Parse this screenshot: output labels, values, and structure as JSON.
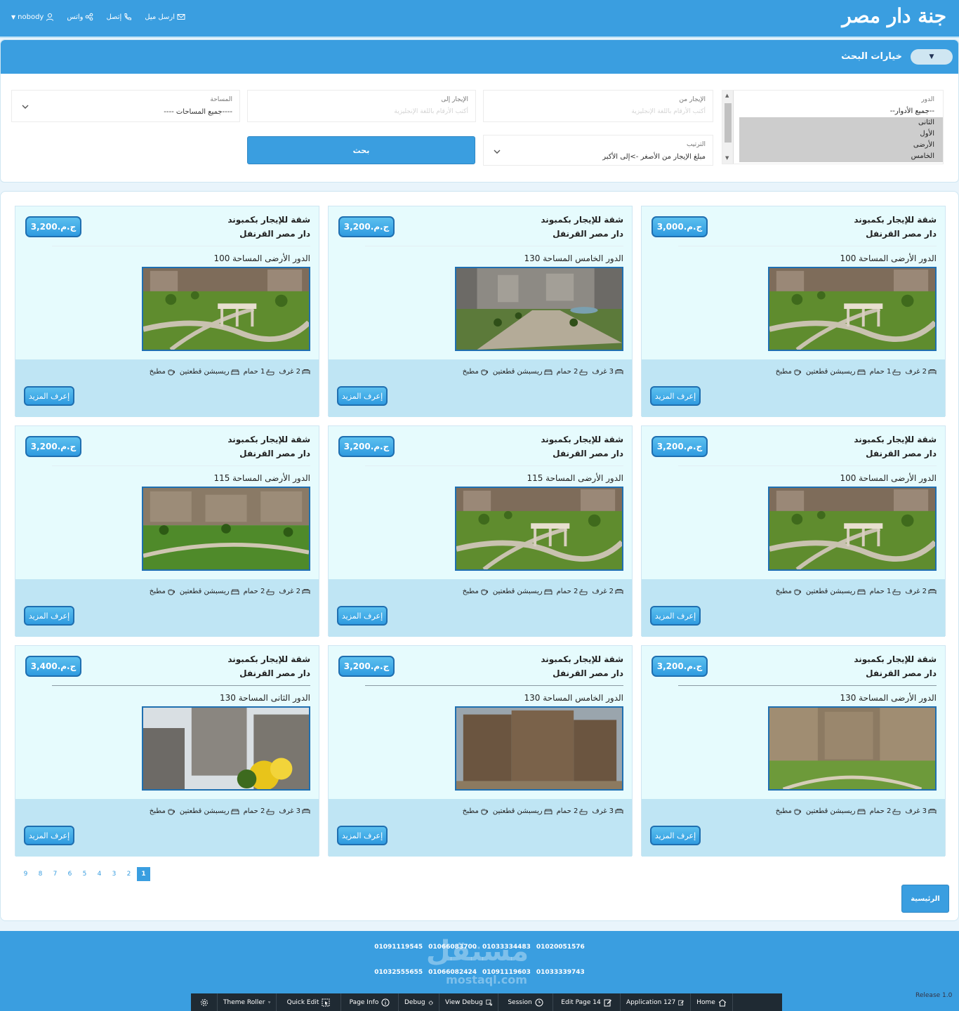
{
  "header": {
    "brand": "جنة دار مصر",
    "links": [
      {
        "label": "ارسل ميل",
        "icon": "mail-icon"
      },
      {
        "label": "إتصل",
        "icon": "phone-icon"
      },
      {
        "label": "واتس",
        "icon": "share-icon"
      },
      {
        "label": "nobody",
        "icon": "user-icon"
      }
    ]
  },
  "search": {
    "title": "خيارات البحث",
    "collapse_icon": "▼",
    "floor": {
      "label": "الدور",
      "options": [
        "--جميع الأدوار--",
        "الثانى",
        "الأول",
        "الأرضى",
        "الخامس"
      ]
    },
    "rent_from": {
      "label": "الإيجار من",
      "placeholder": "أكتب الأرقام باللغة الإنجليزية"
    },
    "rent_to": {
      "label": "الإيجار إلى",
      "placeholder": "أكتب الأرقام باللغة الإنجليزية"
    },
    "area": {
      "label": "المساحة",
      "value": "----جميع المساحات ----"
    },
    "sort": {
      "label": "الترتيب",
      "value": "مبلغ الإيجار من الأصغر ->إلى الأكبر"
    },
    "button": "بحث"
  },
  "listings": [
    {
      "title1": "شقة للإيجار بكمبوند",
      "title2": "دار مصر القرنفل",
      "price": "ج.م.3,000",
      "floor_area": "الدور الأرضى المساحة 100",
      "rooms": "2 غرف",
      "baths": "1 حمام",
      "reception": "ريسبشن قطعتين",
      "kitchen": "مطبخ",
      "more": "إعرف المزيد",
      "photo": "garden"
    },
    {
      "title1": "شقة للإيجار بكمبوند",
      "title2": "دار مصر القرنفل",
      "price": "ج.م.3,200",
      "floor_area": "الدور الخامس المساحة 130",
      "rooms": "3 غرف",
      "baths": "2 حمام",
      "reception": "ريسبشن قطعتين",
      "kitchen": "مطبخ",
      "more": "إعرف المزيد",
      "photo": "aerial"
    },
    {
      "title1": "شقة للإيجار بكمبوند",
      "title2": "دار مصر القرنفل",
      "price": "ج.م.3,200",
      "floor_area": "الدور الأرضى المساحة 100",
      "rooms": "2 غرف",
      "baths": "1 حمام",
      "reception": "ريسبشن قطعتين",
      "kitchen": "مطبخ",
      "more": "إعرف المزيد",
      "photo": "garden"
    },
    {
      "title1": "شقة للإيجار بكمبوند",
      "title2": "دار مصر القرنفل",
      "price": "ج.م.3,200",
      "floor_area": "الدور الأرضى المساحة 100",
      "rooms": "2 غرف",
      "baths": "1 حمام",
      "reception": "ريسبشن قطعتين",
      "kitchen": "مطبخ",
      "more": "إعرف المزيد",
      "photo": "garden"
    },
    {
      "title1": "شقة للإيجار بكمبوند",
      "title2": "دار مصر القرنفل",
      "price": "ج.م.3,200",
      "floor_area": "الدور الأرضى المساحة 115",
      "rooms": "2 غرف",
      "baths": "2 حمام",
      "reception": "ريسبشن قطعتين",
      "kitchen": "مطبخ",
      "more": "إعرف المزيد",
      "photo": "garden"
    },
    {
      "title1": "شقة للإيجار بكمبوند",
      "title2": "دار مصر القرنفل",
      "price": "ج.م.3,200",
      "floor_area": "الدور الأرضى المساحة 115",
      "rooms": "2 غرف",
      "baths": "2 حمام",
      "reception": "ريسبشن قطعتين",
      "kitchen": "مطبخ",
      "more": "إعرف المزيد",
      "photo": "park"
    },
    {
      "title1": "شقة للإيجار بكمبوند",
      "title2": "دار مصر القرنفل",
      "price": "ج.م.3,200",
      "floor_area": "الدور الأرضى المساحة 130",
      "rooms": "3 غرف",
      "baths": "2 حمام",
      "reception": "ريسبشن قطعتين",
      "kitchen": "مطبخ",
      "more": "إعرف المزيد",
      "photo": "blocks"
    },
    {
      "title1": "شقة للإيجار بكمبوند",
      "title2": "دار مصر القرنفل",
      "price": "ج.م.3,200",
      "floor_area": "الدور الخامس المساحة 130",
      "rooms": "3 غرف",
      "baths": "2 حمام",
      "reception": "ريسبشن قطعتين",
      "kitchen": "مطبخ",
      "more": "إعرف المزيد",
      "photo": "building"
    },
    {
      "title1": "شقة للإيجار بكمبوند",
      "title2": "دار مصر القرنفل",
      "price": "ج.م.3,400",
      "floor_area": "الدور الثانى المساحة 130",
      "rooms": "3 غرف",
      "baths": "2 حمام",
      "reception": "ريسبشن قطعتين",
      "kitchen": "مطبخ",
      "more": "إعرف المزيد",
      "photo": "flowers"
    }
  ],
  "pagination": {
    "pages": [
      "9",
      "8",
      "7",
      "6",
      "5",
      "4",
      "3",
      "2",
      "1"
    ],
    "current": "1"
  },
  "home_button": "الرئيسية",
  "footer": {
    "phones_row1": [
      "01091119545",
      "01066083700",
      "01033334483",
      "01020051576"
    ],
    "phones_row2": [
      "01032555655",
      "01066082424",
      "01091119603",
      "01033339743"
    ],
    "watermark": "مستقل",
    "watermark_latin": "mostaql.com",
    "devbar": [
      {
        "label": "",
        "icon": "gear-icon"
      },
      {
        "label": "Theme Roller",
        "icon": "paint-roller-icon"
      },
      {
        "label": "Quick Edit",
        "icon": "quick-edit-icon"
      },
      {
        "label": "Page Info",
        "icon": "info-icon"
      },
      {
        "label": "Debug",
        "icon": "bug-icon"
      },
      {
        "label": "View Debug",
        "icon": "view-debug-icon"
      },
      {
        "label": "Session",
        "icon": "clock-icon"
      },
      {
        "label": "Edit Page 14",
        "icon": "edit-icon"
      },
      {
        "label": "Application 127",
        "icon": "edit-icon"
      },
      {
        "label": "Home",
        "icon": "home-icon"
      }
    ],
    "release": "Release 1.0"
  },
  "colors": {
    "primary": "#3a9ee0",
    "card_bg": "#e6fbfd",
    "card_footer": "#bfe5f4",
    "price_border": "#1f6fb0"
  }
}
